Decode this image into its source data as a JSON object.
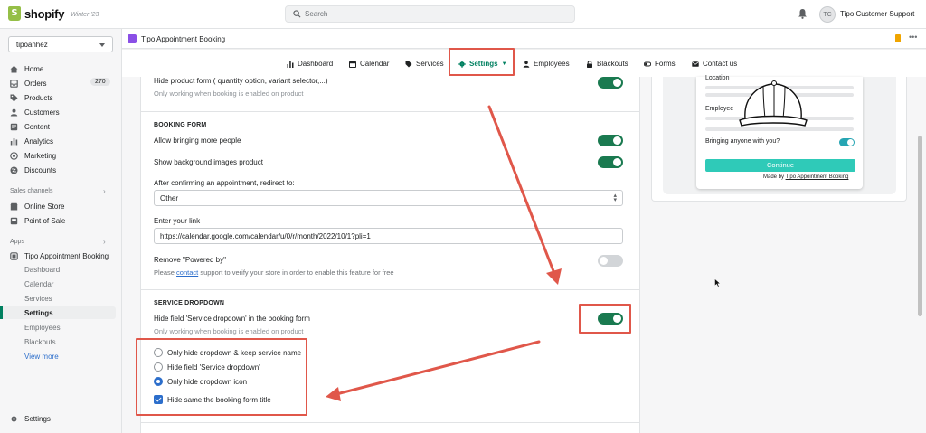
{
  "topbar": {
    "brand": "shopify",
    "edition": "Winter '23",
    "search_placeholder": "Search",
    "user_initials": "TC",
    "user_name": "Tipo Customer Support"
  },
  "sidebar": {
    "store": "tipoanhez",
    "items": [
      {
        "label": "Home"
      },
      {
        "label": "Orders",
        "badge": "270"
      },
      {
        "label": "Products"
      },
      {
        "label": "Customers"
      },
      {
        "label": "Content"
      },
      {
        "label": "Analytics"
      },
      {
        "label": "Marketing"
      },
      {
        "label": "Discounts"
      }
    ],
    "sales_channels_title": "Sales channels",
    "channels": [
      {
        "label": "Online Store"
      },
      {
        "label": "Point of Sale"
      }
    ],
    "apps_title": "Apps",
    "app_name": "Tipo Appointment Booking",
    "app_subitems": [
      "Dashboard",
      "Calendar",
      "Services",
      "Settings",
      "Employees",
      "Blackouts"
    ],
    "view_more": "View more",
    "settings": "Settings"
  },
  "app_header": {
    "title": "Tipo Appointment Booking"
  },
  "tabs": [
    {
      "label": "Dashboard"
    },
    {
      "label": "Calendar"
    },
    {
      "label": "Services"
    },
    {
      "label": "Settings",
      "active": true
    },
    {
      "label": "Employees"
    },
    {
      "label": "Blackouts"
    },
    {
      "label": "Forms"
    },
    {
      "label": "Contact us"
    }
  ],
  "settings": {
    "hide_product_form": "Hide product form ( quantity option, variant selector,...)",
    "hide_product_form_note": "Only working when booking is enabled on product",
    "booking_form_title": "BOOKING FORM",
    "allow_more_people": "Allow bringing more people",
    "show_bg_images": "Show background images product",
    "redirect_label": "After confirming an appointment, redirect to:",
    "redirect_value": "Other",
    "link_label": "Enter your link",
    "link_value": "https://calendar.google.com/calendar/u/0/r/month/2022/10/1?pli=1",
    "remove_powered": "Remove \"Powered by\"",
    "remove_note_pre": "Please",
    "remove_note_link": "contact",
    "remove_note_post": "support to verify your store in order to enable this feature for free",
    "service_dropdown_title": "SERVICE DROPDOWN",
    "hide_service_dropdown": "Hide field 'Service dropdown' in the booking form",
    "hide_service_note": "Only working when booking is enabled on product",
    "radio_options": [
      "Only hide dropdown & keep service name",
      "Hide field 'Service dropdown'",
      "Only hide dropdown icon"
    ],
    "selected_radio": 2,
    "checkbox_label": "Hide same the booking form title"
  },
  "preview": {
    "location_label": "Location",
    "employee_label": "Employee",
    "bringing_label": "Bringing anyone with you?",
    "continue_label": "Continue",
    "made_by": "Made by",
    "made_by_link": "Tipo Appointment Booking"
  },
  "colors": {
    "toggle_on": "#1a7a50",
    "accent_green": "#008060",
    "annotation_red": "#e0574a",
    "link_blue": "#2c6ecb",
    "preview_button": "#2fcab8"
  }
}
